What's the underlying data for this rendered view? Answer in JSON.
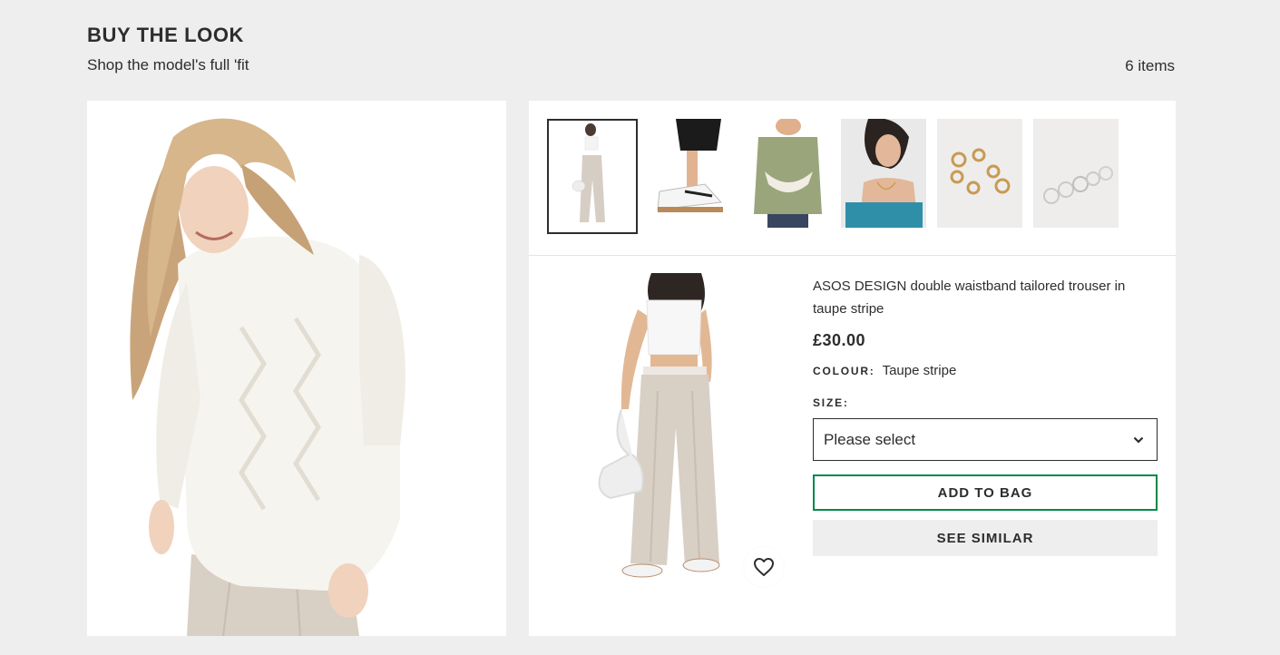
{
  "header": {
    "title": "BUY THE LOOK",
    "subtitle": "Shop the model's full 'fit",
    "item_count": "6 items"
  },
  "thumbnails": [
    {
      "name": "thumb-trousers-look",
      "active": true
    },
    {
      "name": "thumb-trainers",
      "active": false
    },
    {
      "name": "thumb-bum-bag",
      "active": false
    },
    {
      "name": "thumb-necklace",
      "active": false
    },
    {
      "name": "thumb-gold-rings",
      "active": false
    },
    {
      "name": "thumb-silver-rings",
      "active": false
    }
  ],
  "product": {
    "name": "ASOS DESIGN double waistband tailored trouser in taupe stripe",
    "price": "£30.00",
    "colour_label": "COLOUR:",
    "colour_value": "Taupe stripe",
    "size_label": "SIZE:",
    "size_placeholder": "Please select",
    "add_to_bag": "ADD TO BAG",
    "see_similar": "SEE SIMILAR"
  },
  "icons": {
    "wishlist": "heart-icon",
    "dropdown": "chevron-down-icon"
  },
  "colors": {
    "accent_green": "#018849",
    "text": "#2d2d2d",
    "background": "#eeeeee"
  }
}
